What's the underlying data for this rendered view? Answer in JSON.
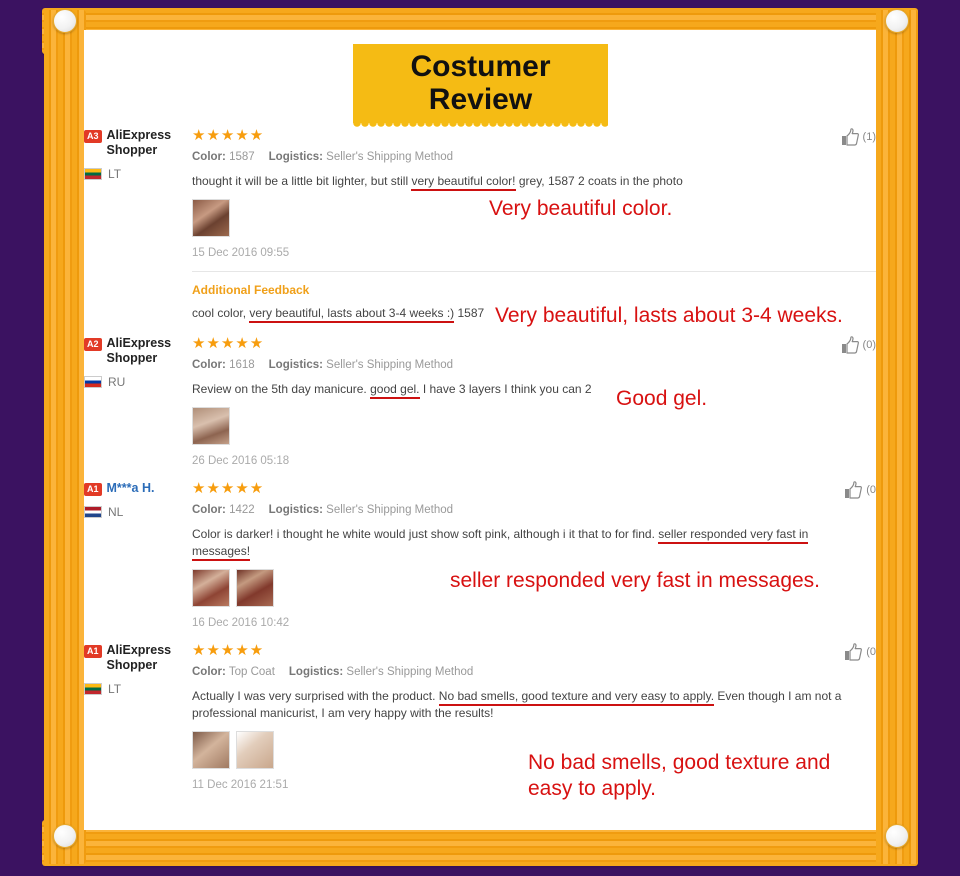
{
  "theme": {
    "background": "#3B1261",
    "frame_color": "#F5A31A",
    "banner_color": "#F5BB14",
    "annotation_color": "#d81111",
    "star_color": "#F79D0E",
    "badge_color": "#E23A26",
    "link_color": "#2b6cb8",
    "additional_feedback_color": "#F0A019"
  },
  "header": {
    "title": "Costumer Review"
  },
  "labels": {
    "color_key": "Color:",
    "logistics_key": "Logistics:",
    "additional_feedback": "Additional Feedback",
    "shipping_method": "Seller's Shipping Method"
  },
  "reviews": [
    {
      "badge": "A3",
      "user": "AliExpress Shopper",
      "user_is_link": false,
      "country_code": "LT",
      "flag": "flag-lt",
      "stars": "★★★★★",
      "color_value": "1587",
      "logistics_value": "Seller's Shipping Method",
      "text_before": "thought it will be a little bit lighter, but still ",
      "text_highlight": "very beautiful color!",
      "text_after": " grey, 1587 2 coats in the photo",
      "date": "15 Dec 2016 09:55",
      "helpful_count": "(1)",
      "thumbs": [
        "thumb-a"
      ],
      "annotation": "Very beautiful color.",
      "additional_feedback": {
        "title": "Additional Feedback",
        "text_before": "cool color, ",
        "text_highlight": "very beautiful, lasts about 3-4 weeks :)",
        "text_after": " 1587",
        "annotation": "Very beautiful, lasts about 3-4 weeks."
      }
    },
    {
      "badge": "A2",
      "user": "AliExpress Shopper",
      "user_is_link": false,
      "country_code": "RU",
      "flag": "flag-ru",
      "stars": "★★★★★",
      "color_value": "1618",
      "logistics_value": "Seller's Shipping Method",
      "text_before": "Review on the 5th day manicure. ",
      "text_highlight": "good gel.",
      "text_after": " I have 3 layers I think you can 2",
      "date": "26 Dec 2016 05:18",
      "helpful_count": "(0)",
      "thumbs": [
        "thumb-b"
      ],
      "annotation": "Good gel."
    },
    {
      "badge": "A1",
      "user": "M***a H.",
      "user_is_link": true,
      "country_code": "NL",
      "flag": "flag-nl",
      "stars": "★★★★★",
      "color_value": "1422",
      "logistics_value": "Seller's Shipping Method",
      "text_before": "Color is darker! i thought he white would just show soft pink, although i it that to for find. ",
      "text_highlight": "seller responded very fast in messages!",
      "text_after": "",
      "date": "16 Dec 2016 10:42",
      "helpful_count": "(0",
      "thumbs": [
        "thumb-c",
        "thumb-d"
      ],
      "annotation": "seller responded very fast in messages."
    },
    {
      "badge": "A1",
      "user": "AliExpress Shopper",
      "user_is_link": false,
      "country_code": "LT",
      "flag": "flag-lt",
      "stars": "★★★★★",
      "color_value": "Top Coat",
      "logistics_value": "Seller's Shipping Method",
      "text_before": "Actually I was very surprised with the product. ",
      "text_highlight": "No bad smells, good texture and very easy to apply.",
      "text_after": " Even though I am not a professional manicurist, I am very happy with the results!",
      "date": "11 Dec 2016 21:51",
      "helpful_count": "(0",
      "thumbs": [
        "thumb-e",
        "thumb-f"
      ],
      "annotation": "No bad smells, good texture and\neasy to apply."
    }
  ]
}
